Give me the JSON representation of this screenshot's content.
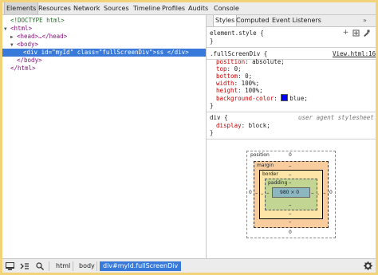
{
  "top_tabs": [
    "Elements",
    "Resources",
    "Network",
    "Sources",
    "Timeline",
    "Profiles",
    "Audits",
    "Console"
  ],
  "dom_tree": {
    "doctype": "<!DOCTYPE html>",
    "html_open": "<html>",
    "head": "<head>…</head>",
    "body_open": "<body>",
    "div_open_tag": "<div ",
    "div_id_attr": "id",
    "div_id_val": "\"myId\"",
    "div_class_attr": "class",
    "div_class_val": "\"fullScreenDiv\"",
    "div_gt": ">",
    "div_text": "ss",
    "div_close": "</div>",
    "body_close": "</body>",
    "html_close": "</html>"
  },
  "styles_panel": {
    "tabs": [
      "Styles",
      "Computed",
      "Event Listeners"
    ],
    "more": "»",
    "element_style": {
      "selector": "element.style {",
      "close": "}"
    },
    "rule1": {
      "selector": ".fullScreenDiv {",
      "source": "View.html:16",
      "props": [
        {
          "name": "position",
          "value": "absolute;"
        },
        {
          "name": "top",
          "value": "0;"
        },
        {
          "name": "bottom",
          "value": "0;"
        },
        {
          "name": "width",
          "value": "100%;"
        },
        {
          "name": "height",
          "value": "100%;"
        },
        {
          "name": "background-color",
          "value": "blue;"
        }
      ],
      "swatch_color": "#0000ff",
      "close": "}"
    },
    "rule2": {
      "selector": "div {",
      "source": "user agent stylesheet",
      "props": [
        {
          "name": "display",
          "value": "block;"
        }
      ],
      "close": "}"
    }
  },
  "box_model": {
    "position_label": "position",
    "position_top": "0",
    "position_bottom": "0",
    "position_left": "0",
    "position_right": "0",
    "margin_label": "margin",
    "border_label": "border",
    "padding_label": "padding",
    "dash": "–",
    "content": "980 × 0"
  },
  "bottom_bar": {
    "crumbs": [
      "html",
      "body",
      "div#myId.fullScreenDiv"
    ]
  },
  "icons": [
    "dock-icon",
    "console-drawer-icon",
    "search-icon",
    "gear-icon",
    "add-rule-icon",
    "toggle-state-icon",
    "color-format-icon"
  ],
  "colors": {
    "selection": "#3879d9",
    "tag": "#881280",
    "attr_name": "#994500",
    "attr_value": "#1a1aa6",
    "css_prop": "#c80000"
  }
}
